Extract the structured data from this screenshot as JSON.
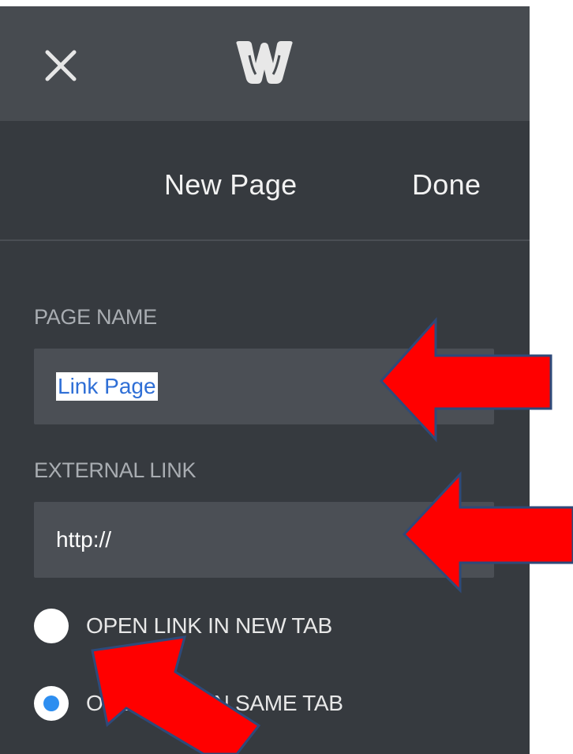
{
  "topbar": {
    "close_icon": "close-icon",
    "logo_icon": "weebly-logo-icon"
  },
  "header": {
    "new_page_label": "New Page",
    "done_label": "Done"
  },
  "form": {
    "page_name_label": "PAGE NAME",
    "page_name_value": "Link Page",
    "external_link_label": "EXTERNAL LINK",
    "external_link_value": "http://",
    "radio_new_tab_label": "OPEN LINK IN NEW TAB",
    "radio_same_tab_label": "OPEN LINK IN SAME TAB",
    "selected_option": "OPEN LINK IN SAME TAB"
  },
  "colors": {
    "panel_bg": "#363a3f",
    "topbar_bg": "#474b50",
    "field_bg": "#4b4f55",
    "radio_checked": "#2d8ef0",
    "annotation_arrow": "#ff0000"
  }
}
